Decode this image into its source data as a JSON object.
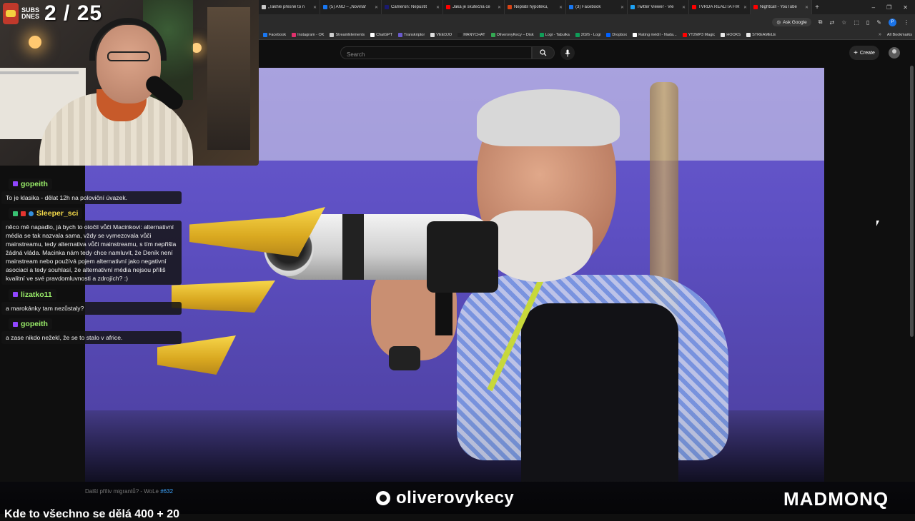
{
  "browser": {
    "tabs": [
      {
        "label": "„Takhle přesně to n",
        "favicon_color": "#c9c9c9"
      },
      {
        "label": "(5) ANO – „Novinář",
        "favicon_color": "#1877f2"
      },
      {
        "label": "Cameron: Nepustit",
        "favicon_color": "#1a1a70"
      },
      {
        "label": "Jaká je skutečná ce",
        "favicon_color": "#ff0000"
      },
      {
        "label": "Neplatil hypotéku,",
        "favicon_color": "#d84315"
      },
      {
        "label": "(3) Facebook",
        "favicon_color": "#1877f2"
      },
      {
        "label": "Twitter Viewer - Vie",
        "favicon_color": "#1da1f2"
      },
      {
        "label": "TVRDÁ REALITA FIR",
        "favicon_color": "#ff0000"
      },
      {
        "label": "Nightcall - YouTube",
        "favicon_color": "#ff0000"
      }
    ],
    "new_tab": "+",
    "window_controls": [
      "–",
      "❐",
      "✕"
    ],
    "toolbar": {
      "ask_google": "Ask Google",
      "profile_initial": "P"
    },
    "bookmarks": [
      {
        "label": "Facebook",
        "color": "#1877f2"
      },
      {
        "label": "Instagram - OK",
        "color": "#e1306c"
      },
      {
        "label": "StreamElements",
        "color": "#cccccc"
      },
      {
        "label": "ChatGPT",
        "color": "#ffffff"
      },
      {
        "label": "Transkriptor",
        "color": "#6a5acd"
      },
      {
        "label": "VEEDJO",
        "color": "#dddddd"
      },
      {
        "label": "MANYCHAT",
        "color": "#222222"
      },
      {
        "label": "OliverovyKecy – Disk",
        "color": "#34a853"
      },
      {
        "label": "Logi - Tabulka",
        "color": "#0f9d58"
      },
      {
        "label": "2026 - Logi",
        "color": "#0f9d58"
      },
      {
        "label": "Dropbox",
        "color": "#0061ff"
      },
      {
        "label": "Rating médií - Nada...",
        "color": "#ffffff"
      },
      {
        "label": "YT2MP3 Magic",
        "color": "#ff0000"
      },
      {
        "label": "HOOKS",
        "color": "#e8e8e8"
      },
      {
        "label": "STREAMELE",
        "color": "#e8e8e8"
      }
    ],
    "all_bookmarks": "All Bookmarks"
  },
  "youtube": {
    "search_placeholder": "Search",
    "create_label": "Create"
  },
  "stream": {
    "subs_label": "SUBS DNES",
    "subs_count": "2 / 25",
    "chat": [
      {
        "user": "gopeith",
        "text": "To je klasika - dělat 12h na poloviční úvazek."
      },
      {
        "user": "Sleeper_sci",
        "text": "něco mě napadlo, já bych to otočil vůči Macinkovi: alternativní média se tak nazvala sama, vždy se vymezovala vůči mainstreamu, tedy alternativa vůči mainstreamu, s tím nepřišla žádná vláda. Macinka nám tedy chce namluvit, že Deník není mainstream nebo používá pojem alternativní jako negativní asociaci a tedy souhlasí, že alternativní média nejsou příliš kvalitní ve své pravdomluvnosti a zdrojích? :)"
      },
      {
        "user": "lizatko11",
        "text": "a marokánky tam nezůstaly?"
      },
      {
        "user": "gopeith",
        "text": "a zase nikdo nežekl, že se to stalo v africe."
      }
    ],
    "video_caption": "Další příliv migrantů? - WoLe",
    "video_caption_tag": "#632",
    "channel_handle": "oliverovykecy",
    "sponsor": "MADMONQ",
    "ticker": "Kde to všechno se dělá 400 + 20"
  },
  "colors": {
    "accent_purple": "#5d4fc2",
    "username_green": "#9bef6a",
    "gold": "#e8c13a"
  }
}
